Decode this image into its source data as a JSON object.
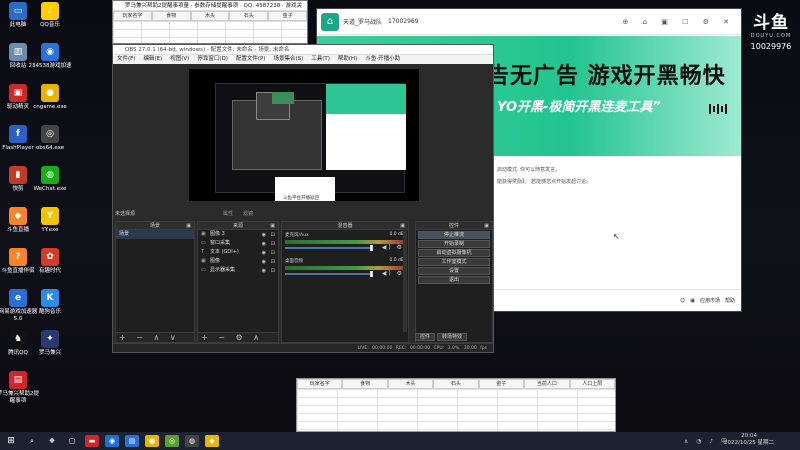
{
  "desktop": {
    "icons": [
      {
        "label": "此电脑",
        "glyph": "▭",
        "color": "#2b6cc4"
      },
      {
        "label": "QQ音乐",
        "glyph": "♪",
        "color": "#ffcc00"
      },
      {
        "label": "回收站",
        "glyph": "▥",
        "color": "#6b8cab"
      },
      {
        "label": "234538游戏加速",
        "glyph": "◉",
        "color": "#2a72d6"
      },
      {
        "label": "驱动精灵",
        "glyph": "▣",
        "color": "#cc2a2a"
      },
      {
        "label": "cngame.exe",
        "glyph": "●",
        "color": "#e9b400"
      },
      {
        "label": "FlashPlayer",
        "glyph": "f",
        "color": "#2a5fc4"
      },
      {
        "label": "obs64.exe",
        "glyph": "◎",
        "color": "#444"
      },
      {
        "label": "快剪",
        "glyph": "▮",
        "color": "#c43a2a"
      },
      {
        "label": "WeChat.exe",
        "glyph": "◍",
        "color": "#1aad19"
      },
      {
        "label": "斗鱼直播",
        "glyph": "◆",
        "color": "#f7832a"
      },
      {
        "label": "YY.exe",
        "glyph": "Y",
        "color": "#f2c300"
      },
      {
        "label": "斗鱼直播伴侣",
        "glyph": "?",
        "color": "#f7832a"
      },
      {
        "label": "有趣时代",
        "glyph": "✿",
        "color": "#d23c2a"
      },
      {
        "label": "网易游戏加速器5.0",
        "glyph": "e",
        "color": "#2a6fd6"
      },
      {
        "label": "酷狗音乐",
        "glyph": "K",
        "color": "#2a8be8"
      },
      {
        "label": "腾讯QQ",
        "glyph": "♞",
        "color": "#111"
      },
      {
        "label": "罗马兼兴",
        "glyph": "✦",
        "color": "#2a3a6e"
      },
      {
        "label": "罗马兼兴帮助2提醒事项",
        "glyph": "▤",
        "color": "#d2262a"
      }
    ]
  },
  "excel_top": {
    "title": "罗马兼兴帮助2提醒事项量 · 参数存储提醒事项 · QQ: 4587238 · 游戏关注号",
    "columns": [
      "玩家名字",
      "食物",
      "木头",
      "石头",
      "金子"
    ]
  },
  "douyu": {
    "tab_title": "天道_罗马战队",
    "phone": "17002969",
    "banner_heading": "告无广告 游戏开黑畅快",
    "banner_sub": "YO开黑-极简开黑连麦工具”",
    "content_line1": "启动模式, 你可以随意发言。",
    "content_line2": "能获得奖励】。 若能够您点开始发起讨论。",
    "bottom_items": [
      "应用市场",
      "帮助"
    ]
  },
  "douyu_logo": {
    "main": "斗鱼",
    "sub": "DOUYU.COM",
    "room": "10029976"
  },
  "obs": {
    "title": "OBS 27.0.1 (64-bit, windows) - 配置文件: 未命名 - 场景: 未命名",
    "menu": [
      "文件(F)",
      "编辑(E)",
      "视图(V)",
      "停靠窗口(D)",
      "配置文件(P)",
      "场景集合(S)",
      "工具(T)",
      "帮助(H)",
      "斗鱼·开播小助"
    ],
    "preview_label": "斗鱼平台开播返回",
    "no_source": "未选择源",
    "tabs": [
      "属性",
      "滤镜"
    ],
    "scenes_title": "场景",
    "scenes": [
      "场景"
    ],
    "sources_title": "来源",
    "sources": [
      {
        "name": "图像 3",
        "icon": "▣"
      },
      {
        "name": "窗口采集",
        "icon": "▭"
      },
      {
        "name": "文本 (GDI+)",
        "icon": "T"
      },
      {
        "name": "图像",
        "icon": "▣"
      },
      {
        "name": "显示器采集",
        "icon": "▭"
      }
    ],
    "mixer_title": "混音器",
    "mixer": [
      {
        "name": "麦克风/Aux",
        "db": "0.0 dB"
      },
      {
        "name": "桌面音频",
        "db": "0.0 dB"
      }
    ],
    "controls_title": "控件",
    "controls": [
      "停止推流",
      "开始录制",
      "启动虚拟摄像机",
      "工作室模式",
      "设置",
      "退出"
    ],
    "dock_tabs": [
      "控件",
      "转场特效"
    ],
    "status": "LIVE: 00:00:00    REC: 00:00:00    CPU: 3.0%, 30.00 fps"
  },
  "excel_bottom": {
    "columns": [
      "玩家名字",
      "食物",
      "木头",
      "石头",
      "金子",
      "当前人口",
      "人口上限"
    ]
  },
  "taskbar": {
    "time": "20:04",
    "date": "2022/10/25 星期二",
    "apps": [
      {
        "glyph": "❖",
        "color": "#1c2230"
      },
      {
        "glyph": "▢",
        "color": "#1c2230"
      },
      {
        "glyph": "▬",
        "color": "#d2262a"
      },
      {
        "glyph": "◉",
        "color": "#1e6fd6"
      },
      {
        "glyph": "▤",
        "color": "#2a6fd6"
      },
      {
        "glyph": "●",
        "color": "#e9b400"
      },
      {
        "glyph": "◎",
        "color": "#5aa02c"
      },
      {
        "glyph": "◍",
        "color": "#444"
      },
      {
        "glyph": "◆",
        "color": "#e8b800"
      }
    ]
  }
}
